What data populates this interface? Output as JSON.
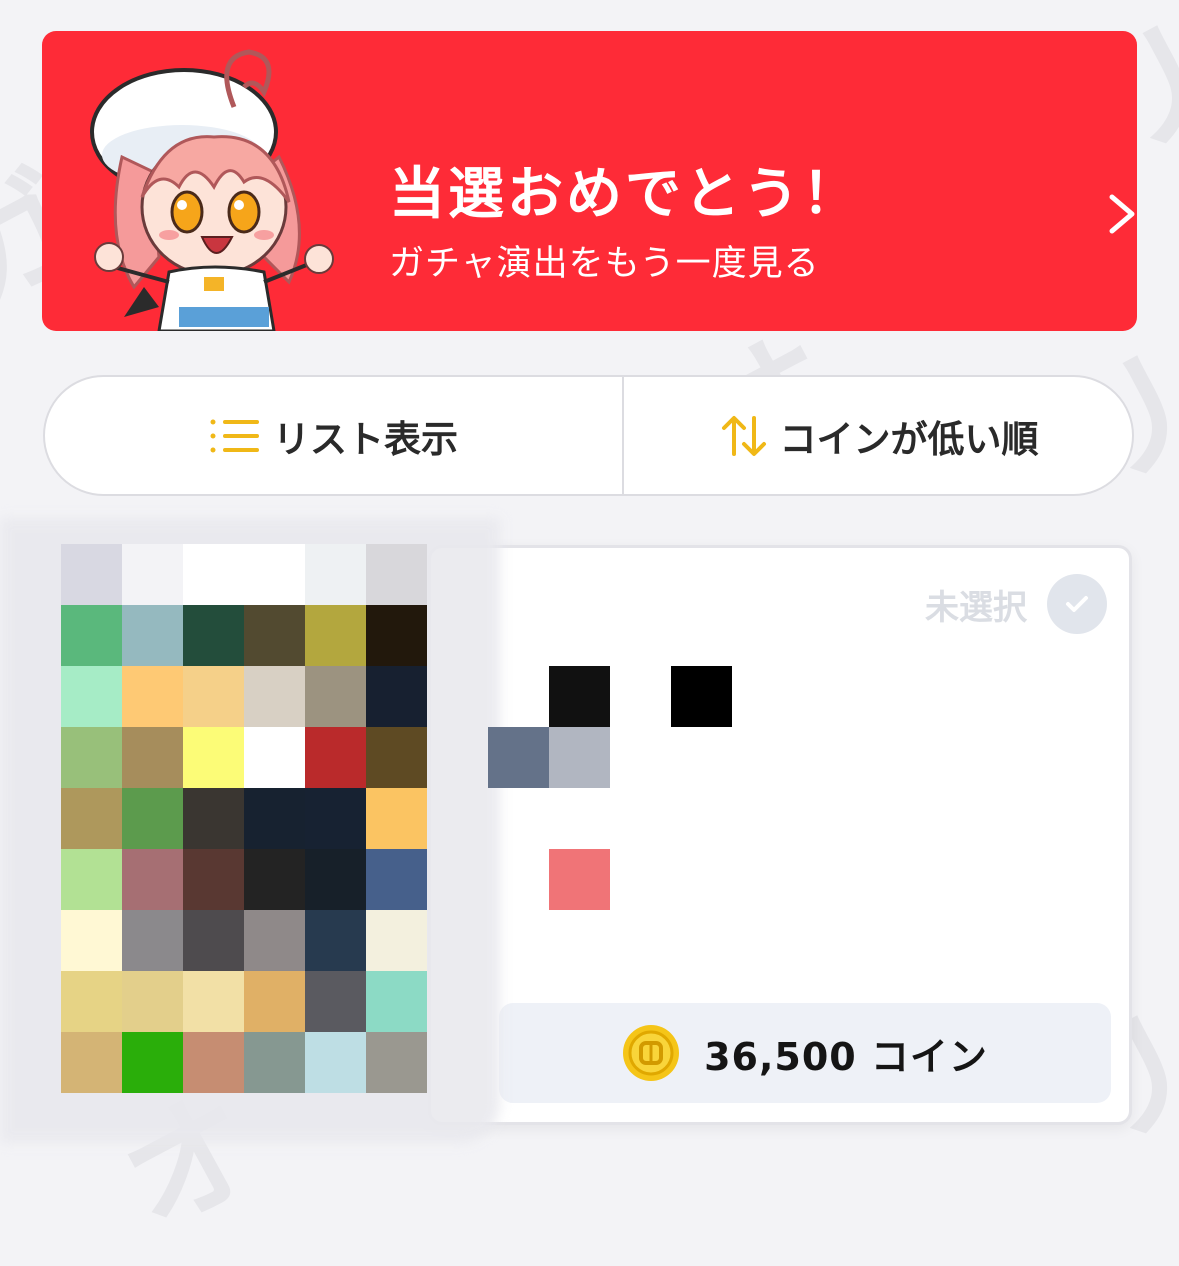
{
  "banner": {
    "title": "当選おめでとう！",
    "subtitle": "ガチャ演出をもう一度見る",
    "background_color": "#fe2b37"
  },
  "view_toggle": {
    "list_view_label": "リスト表示",
    "sort_label": "コインが低い順",
    "accent_color": "#f0b817"
  },
  "item_card": {
    "selection_status": "未選択",
    "price_label": "36,500 コイン",
    "coin_color": "#f5c518"
  },
  "mosaic_colors": [
    [
      "#d8d8e2",
      "#f3f3f6",
      "#ffffff",
      "#ffffff",
      "#eef1f3",
      "#d8d7db"
    ],
    [
      "#5ab87c",
      "#95b9bf",
      "#234d3b",
      "#524a30",
      "#b3a73e",
      "#22180c"
    ],
    [
      "#a6ecc6",
      "#fec974",
      "#f5d089",
      "#d8d0c4",
      "#9c9380",
      "#172030"
    ],
    [
      "#98c07a",
      "#a68d5c",
      "#fcfc77",
      "#ffffff",
      "#ba2a2b",
      "#5e4a23"
    ],
    [
      "#ae985c",
      "#5c9b4d",
      "#3a3631",
      "#172230",
      "#172232",
      "#fbc462"
    ],
    [
      "#b2e194",
      "#a66f73",
      "#593832",
      "#232323",
      "#172029",
      "#46608b"
    ],
    [
      "#fff8d4",
      "#8b898c",
      "#4e4b4e",
      "#8f8989",
      "#273a4f",
      "#f3f0de"
    ],
    [
      "#e6d385",
      "#e3cf8b",
      "#f2e0a6",
      "#e0b066",
      "#5a5a60",
      "#8cdac5"
    ],
    [
      "#d4b475",
      "#2aae0a",
      "#c68d72",
      "#869891",
      "#bedee4",
      "#9a9890"
    ]
  ]
}
